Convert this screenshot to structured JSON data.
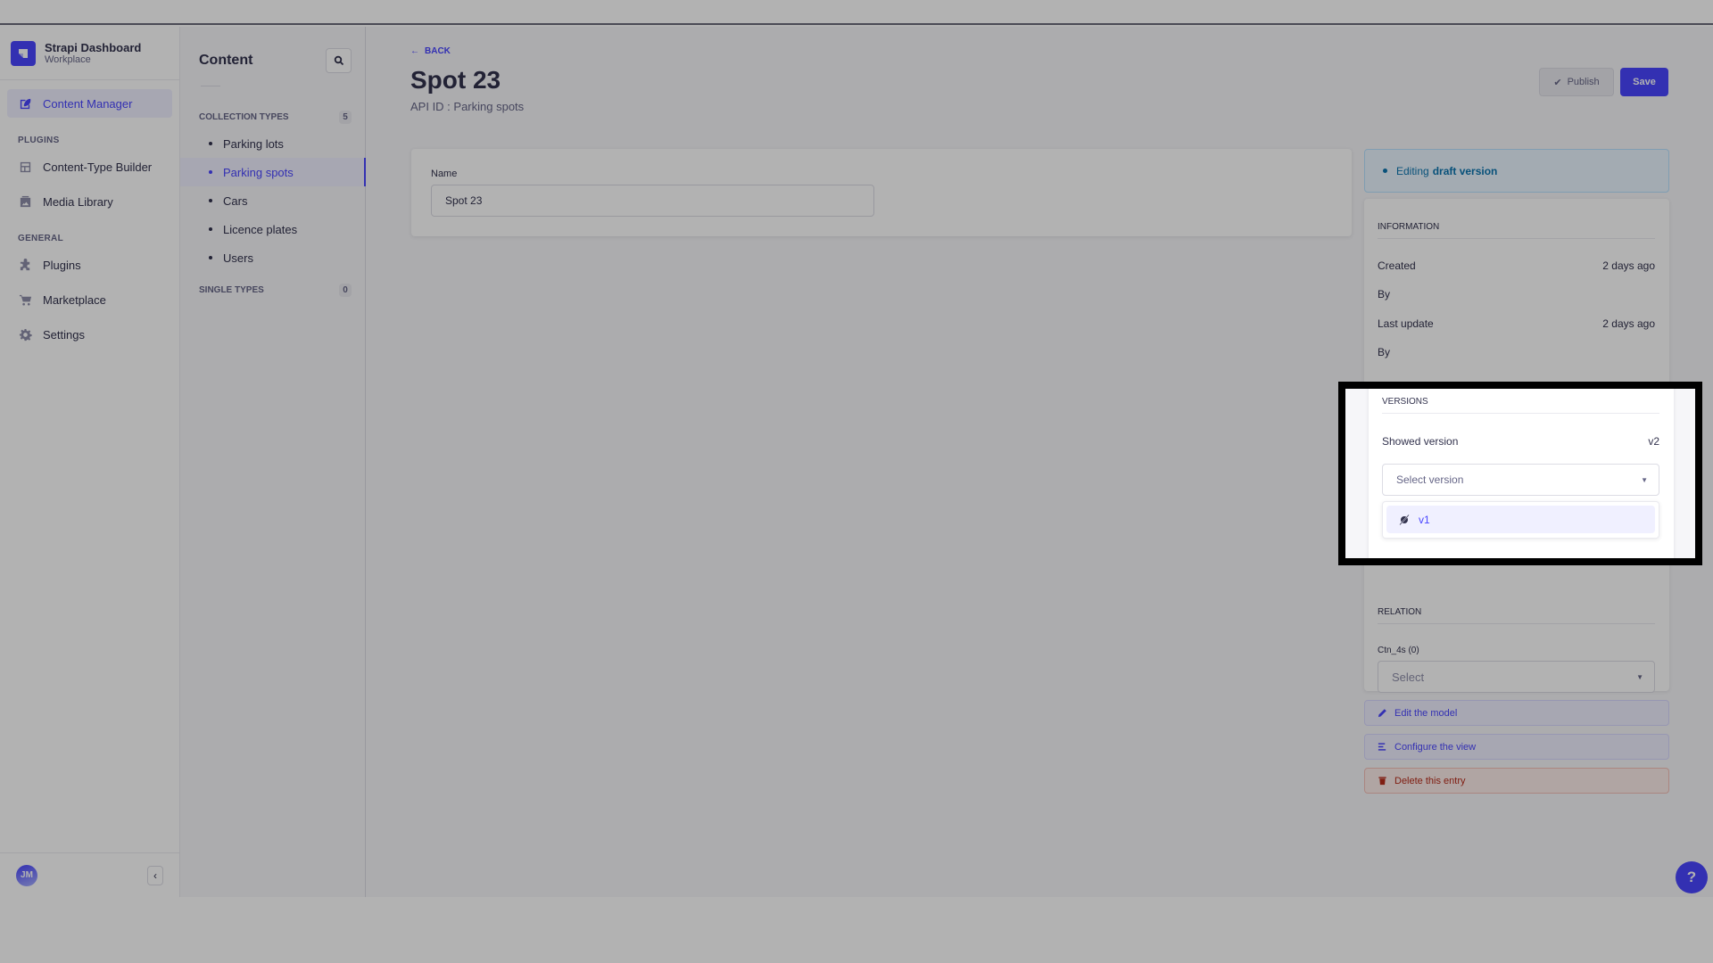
{
  "brand": {
    "title": "Strapi Dashboard",
    "subtitle": "Workplace"
  },
  "mainnav": {
    "active": {
      "label": "Content Manager",
      "icon": "feather-pen-icon"
    },
    "sections": [
      {
        "title": "Plugins",
        "items": [
          {
            "label": "Content-Type Builder",
            "icon": "layout-icon"
          },
          {
            "label": "Media Library",
            "icon": "image-icon"
          }
        ]
      },
      {
        "title": "General",
        "items": [
          {
            "label": "Plugins",
            "icon": "puzzle-icon"
          },
          {
            "label": "Marketplace",
            "icon": "cart-icon"
          },
          {
            "label": "Settings",
            "icon": "gear-icon"
          }
        ]
      }
    ],
    "user_initials": "JM",
    "collapse_icon": "chevron-left-icon"
  },
  "subnav": {
    "title": "Content",
    "search_icon": "search-icon",
    "collection_types": {
      "title": "Collection Types",
      "count": "5",
      "items": [
        "Parking lots",
        "Parking spots",
        "Cars",
        "Licence plates",
        "Users"
      ],
      "active": "Parking spots"
    },
    "single_types": {
      "title": "Single Types",
      "count": "0"
    }
  },
  "header": {
    "back_label": "Back",
    "title": "Spot 23",
    "api_id": "API ID : Parking spots",
    "publish_label": "Publish",
    "save_label": "Save"
  },
  "form": {
    "name_label": "Name",
    "name_value": "Spot 23"
  },
  "draft_banner": {
    "prefix": "Editing",
    "emphasis": "draft version"
  },
  "information": {
    "title": "Information",
    "created_label": "Created",
    "created_value": "2 days ago",
    "created_by_label": "By",
    "updated_label": "Last update",
    "updated_value": "2 days ago",
    "updated_by_label": "By"
  },
  "versions": {
    "title": "Versions",
    "showed_label": "Showed version",
    "showed_value": "v2",
    "select_placeholder": "Select version",
    "options": [
      "v1"
    ]
  },
  "relation": {
    "title": "Relation",
    "field_label": "Ctn_4s (0)",
    "select_placeholder": "Select"
  },
  "actions": {
    "edit_model": "Edit the model",
    "configure_view": "Configure the view",
    "delete_entry": "Delete this entry"
  },
  "help_label": "?",
  "colors": {
    "primary": "#4945ff",
    "danger": "#b72b1a",
    "info": "#0c75af"
  }
}
